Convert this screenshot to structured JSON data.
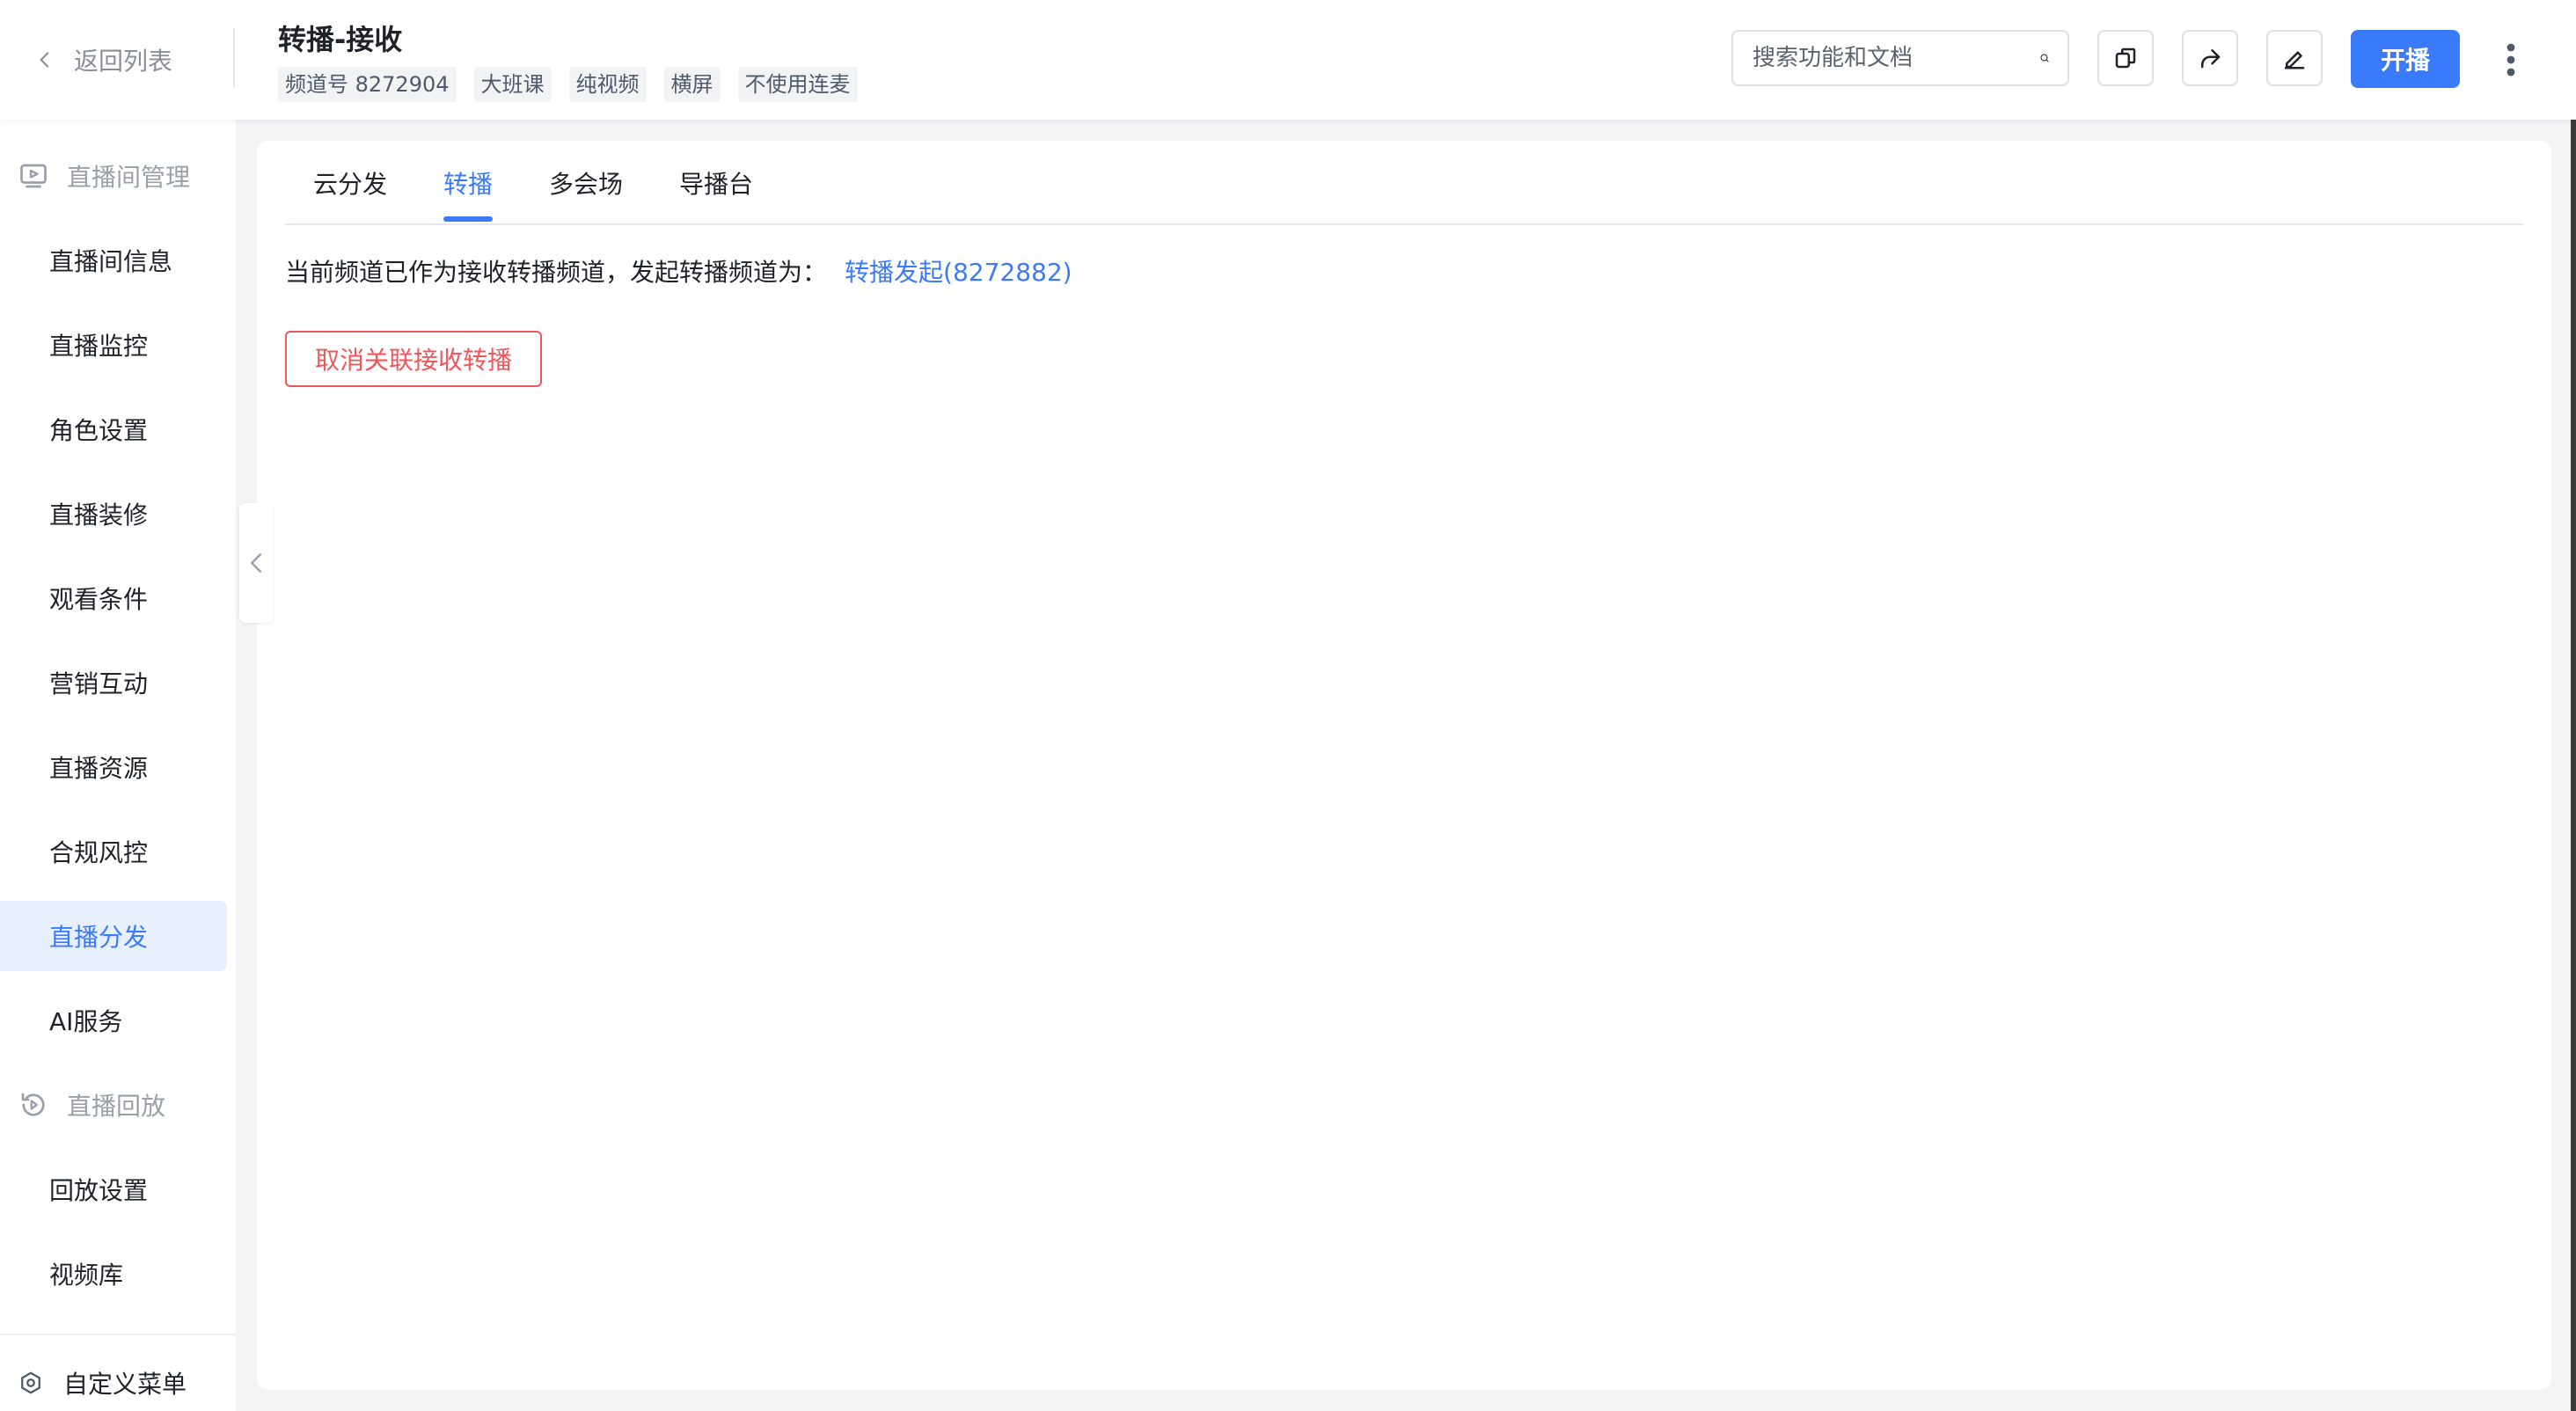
{
  "header": {
    "back_label": "返回列表",
    "title": "转播-接收",
    "tags": [
      "频道号 8272904",
      "大班课",
      "纯视频",
      "横屏",
      "不使用连麦"
    ],
    "search_placeholder": "搜索功能和文档",
    "start_label": "开播"
  },
  "sidebar": {
    "group_live_room": "直播间管理",
    "items": [
      "直播间信息",
      "直播监控",
      "角色设置",
      "直播装修",
      "观看条件",
      "营销互动",
      "直播资源",
      "合规风控",
      "直播分发",
      "AI服务"
    ],
    "active_item": "直播分发",
    "group_playback": "直播回放",
    "playback_items": [
      "回放设置",
      "视频库"
    ],
    "custom_menu": "自定义菜单"
  },
  "main": {
    "tabs": [
      "云分发",
      "转播",
      "多会场",
      "导播台"
    ],
    "active_tab": "转播",
    "info_text": "当前频道已作为接收转播频道，发起转播频道为：",
    "info_link": "转播发起(8272882)",
    "cancel_button": "取消关联接收转播"
  },
  "colors": {
    "accent": "#3a7bfd",
    "danger": "#f0565b",
    "active_bg": "#e8f0ff"
  },
  "icons": [
    "chevron-left-icon",
    "search-icon",
    "copy-icon",
    "share-icon",
    "edit-icon",
    "more-vertical-icon",
    "live-room-icon",
    "playback-icon",
    "custom-menu-icon"
  ]
}
